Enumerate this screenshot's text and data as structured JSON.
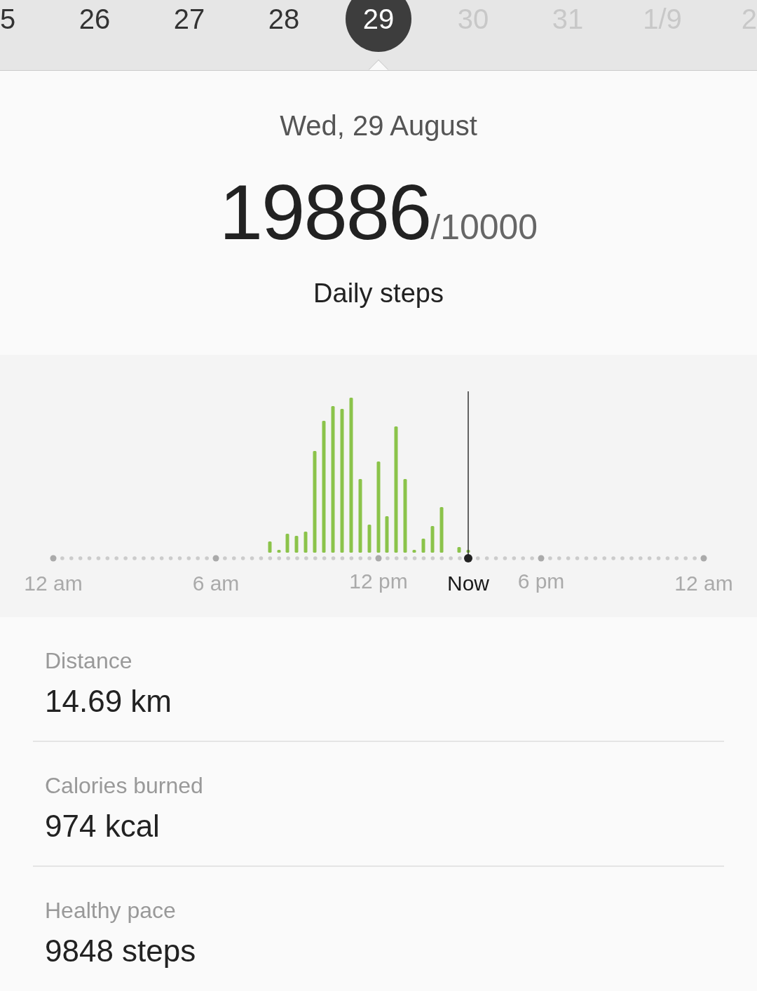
{
  "date_strip": {
    "days": [
      {
        "label": "5",
        "selected": false,
        "disabled": false
      },
      {
        "label": "26",
        "selected": false,
        "disabled": false
      },
      {
        "label": "27",
        "selected": false,
        "disabled": false
      },
      {
        "label": "28",
        "selected": false,
        "disabled": false
      },
      {
        "label": "29",
        "selected": true,
        "disabled": false
      },
      {
        "label": "30",
        "selected": false,
        "disabled": true
      },
      {
        "label": "31",
        "selected": false,
        "disabled": true
      },
      {
        "label": "1/9",
        "selected": false,
        "disabled": true
      },
      {
        "label": "2",
        "selected": false,
        "disabled": true
      }
    ]
  },
  "summary": {
    "date": "Wed, 29 August",
    "steps": "19886",
    "goal": "/10000",
    "caption": "Daily steps"
  },
  "chart": {
    "x_labels": [
      {
        "label": "12 am",
        "kind": "tick"
      },
      {
        "label": "6 am",
        "kind": "tick"
      },
      {
        "label": "12 pm",
        "kind": "tick"
      },
      {
        "label": "Now",
        "kind": "now"
      },
      {
        "label": "6 pm",
        "kind": "tick"
      },
      {
        "label": "12 am",
        "kind": "tick"
      }
    ]
  },
  "stats": [
    {
      "label": "Distance",
      "value": "14.69 km"
    },
    {
      "label": "Calories burned",
      "value": "974 kcal"
    },
    {
      "label": "Healthy pace",
      "value": "9848 steps"
    }
  ]
}
